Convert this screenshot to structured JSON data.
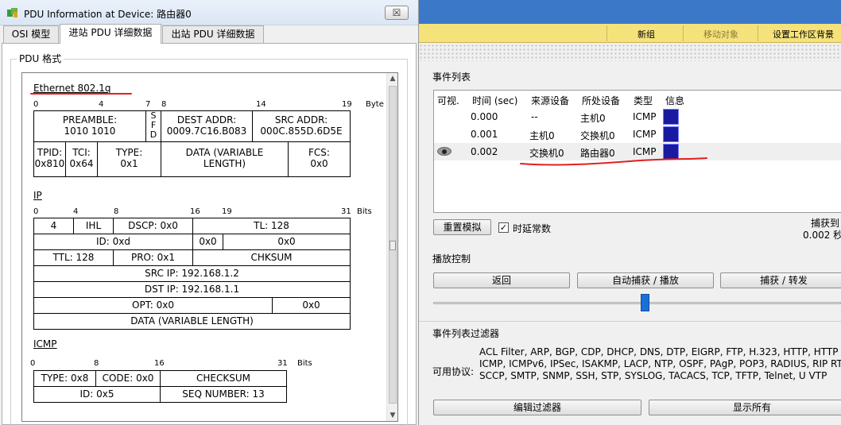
{
  "left_window": {
    "title": "PDU Information at Device: 路由器0",
    "close_label": "☒",
    "tabs": [
      "OSI 模型",
      "进站 PDU 详细数据",
      "出站 PDU 详细数据"
    ],
    "active_tab": 1,
    "group_label": "PDU 格式",
    "ethernet": {
      "title": "Ethernet 802.1q",
      "bits": [
        "0",
        "4",
        "7",
        "8",
        "14",
        "19"
      ],
      "bits_unit": "Byte",
      "preamble": "PREAMBLE:\n1010 1010",
      "sfd": "S\nF\nD",
      "dest_addr": "DEST ADDR:\n0009.7C16.B083",
      "src_addr": "SRC ADDR:\n000C.855D.6D5E",
      "tpid": "TPID:\n0x810",
      "tci": "TCI:\n0x64",
      "type": "TYPE:\n0x1",
      "data": "DATA (VARIABLE\nLENGTH)",
      "fcs": "FCS:\n0x0"
    },
    "ip": {
      "title": "IP",
      "bits": [
        "0",
        "4",
        "8",
        "16",
        "19",
        "31"
      ],
      "bits_unit": "Bits",
      "version": "4",
      "ihl": "IHL",
      "dscp": "DSCP: 0x0",
      "tl": "TL: 128",
      "id": "ID: 0xd",
      "flags": "0x0",
      "frag": "0x0",
      "ttl": "TTL: 128",
      "pro": "PRO: 0x1",
      "chksum": "CHKSUM",
      "src_ip": "SRC IP: 192.168.1.2",
      "dst_ip": "DST IP: 192.168.1.1",
      "opt": "OPT: 0x0",
      "opt_pad": "0x0",
      "data": "DATA (VARIABLE LENGTH)"
    },
    "icmp": {
      "title": "ICMP",
      "bits": [
        "0",
        "8",
        "16",
        "31"
      ],
      "bits_unit": "Bits",
      "type": "TYPE: 0x8",
      "code": "CODE: 0x0",
      "checksum": "CHECKSUM",
      "id": "ID: 0x5",
      "seq": "SEQ NUMBER: 13"
    }
  },
  "right_window": {
    "toolbar": [
      "新组",
      "移动对象",
      "设置工作区背景"
    ],
    "event_list_label": "事件列表",
    "columns": [
      "可视.",
      "时间 (sec)",
      "来源设备",
      "所处设备",
      "类型",
      "信息"
    ],
    "events": [
      {
        "time": "0.000",
        "from": "--",
        "at": "主机0",
        "type": "ICMP",
        "visible": false
      },
      {
        "time": "0.001",
        "from": "主机0",
        "at": "交换机0",
        "type": "ICMP",
        "visible": false
      },
      {
        "time": "0.002",
        "from": "交换机0",
        "at": "路由器0",
        "type": "ICMP",
        "visible": true
      }
    ],
    "reset_label": "重置模拟",
    "const_delay_label": "时延常数",
    "capture_label": "捕获到",
    "capture_time": "0.002 秒",
    "playback_label": "播放控制",
    "back_label": "返回",
    "auto_label": "自动捕获 / 播放",
    "capture_forward_label": "捕获 / 转发",
    "filter_label": "事件列表过滤器",
    "protocols_label": "可用协议:",
    "protocols": "ACL Filter, ARP, BGP, CDP, DHCP, DNS, DTP, EIGRP, FTP, H.323, HTTP, HTTP ICMP, ICMPv6, IPSec, ISAKMP, LACP, NTP, OSPF, PAgP, POP3, RADIUS, RIP RTP, SCCP, SMTP, SNMP, SSH, STP, SYSLOG, TACACS, TCP, TFTP, Telnet, U VTP",
    "edit_filter_label": "编辑过滤器",
    "show_all_label": "显示所有"
  }
}
